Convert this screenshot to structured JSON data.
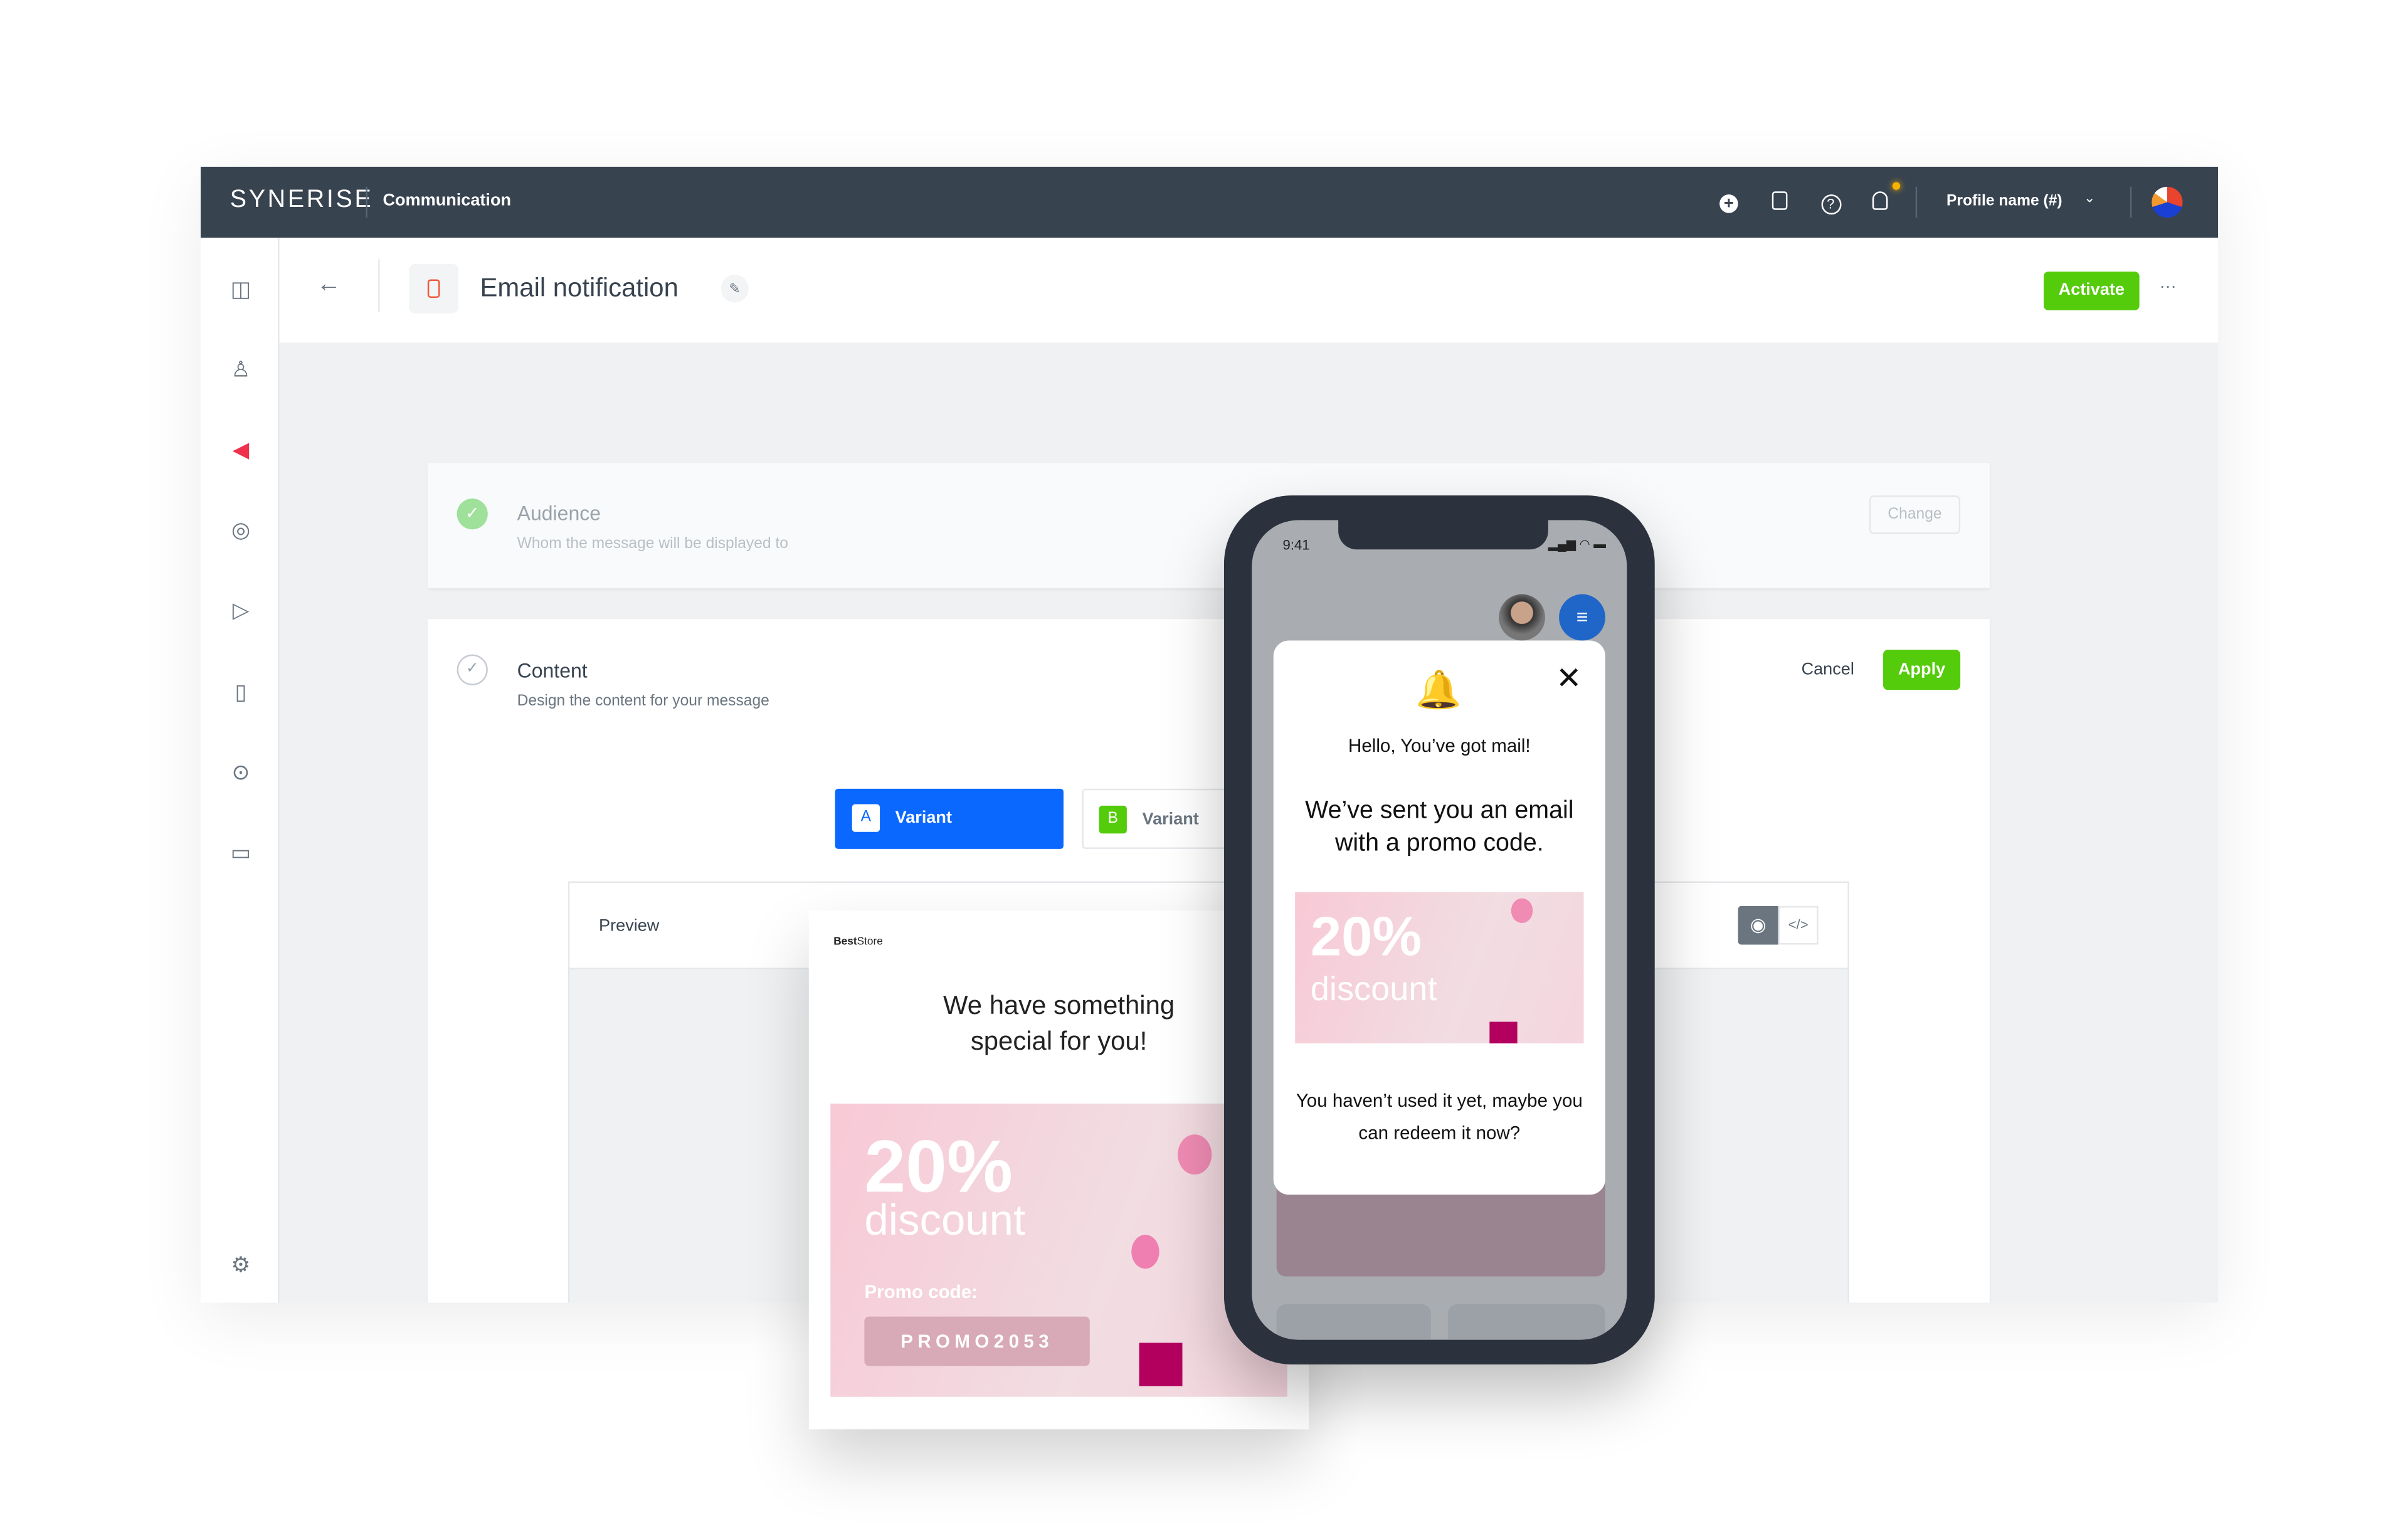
{
  "topbar": {
    "logo": "SYNERISE",
    "section": "Communication",
    "profile": "Profile name (#)",
    "icons": [
      "plus-circle-icon",
      "book-icon",
      "help-icon",
      "bell-icon"
    ]
  },
  "sidebar": {
    "icons": [
      "layout-icon",
      "user-icon",
      "megaphone-icon",
      "target-icon",
      "play-icon",
      "chart-icon",
      "search-icon",
      "folder-icon",
      "settings-icon"
    ],
    "active_color": "#f0314b"
  },
  "header": {
    "title": "Email notification",
    "activate": "Activate",
    "more": "···"
  },
  "audience": {
    "title": "Audience",
    "subtitle": "Whom the message will be displayed to",
    "change": "Change"
  },
  "content": {
    "title": "Content",
    "subtitle": "Design the content for your message",
    "cancel": "Cancel",
    "apply": "Apply",
    "variants": [
      {
        "letter": "A",
        "label": "Variant",
        "active": true
      },
      {
        "letter": "B",
        "label": "Variant",
        "active": false
      }
    ],
    "preview_label": "Preview"
  },
  "email": {
    "brand_bold": "Best",
    "brand_rest": "Store",
    "headline": "We have something special for you!",
    "percent": "20%",
    "discount": "discount",
    "promo_label": "Promo code:",
    "promo_code": "PROMO2053"
  },
  "phone": {
    "time": "9:41",
    "hello": "Hello, You’ve got mail!",
    "message": "We’ve sent you an email with a promo code.",
    "percent": "20%",
    "discount": "discount",
    "footer": "You haven’t used it yet, maybe you can redeem it now?"
  },
  "colors": {
    "topbar": "#384350",
    "green": "#54cb0b",
    "blue": "#0b68ff",
    "menu_blue": "#1f66c8"
  }
}
